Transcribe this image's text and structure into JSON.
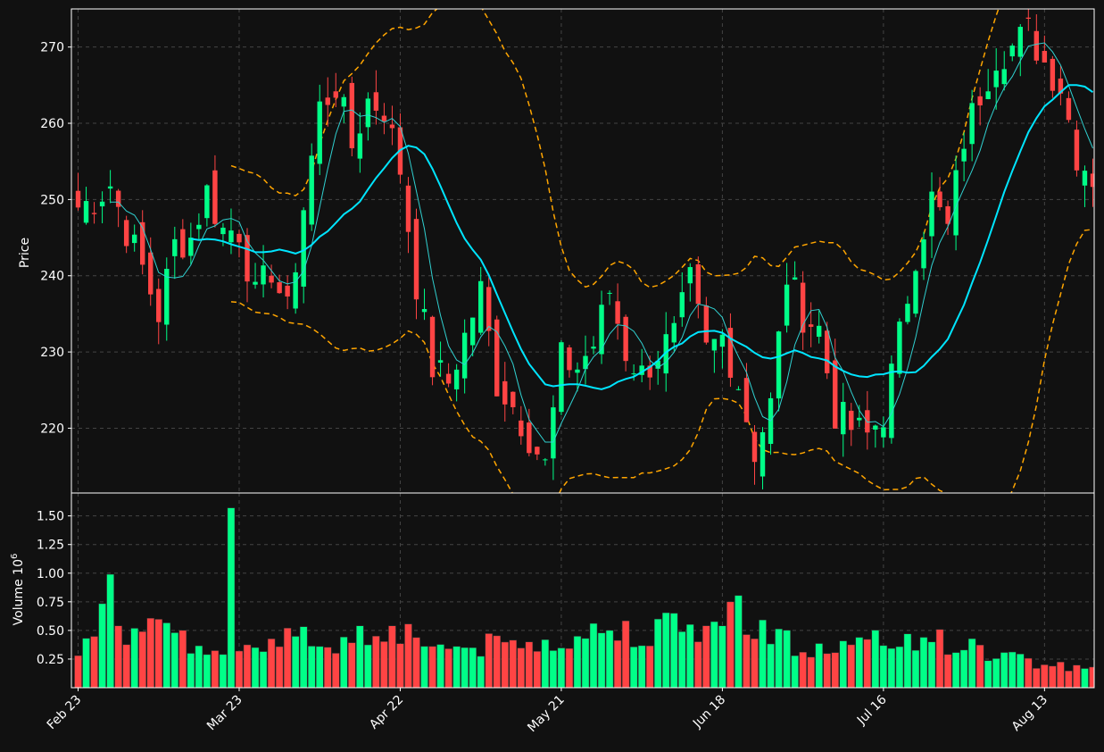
{
  "chart_data": {
    "type": "candlestick",
    "title": "",
    "background_color": "#111111",
    "grid": true,
    "colors": {
      "up": "#00ff88",
      "down": "#ff4444",
      "ma_fast": "#30d0d0",
      "ma_slow": "#00e5ff",
      "band": "#ffa500",
      "frame": "#ffffff"
    },
    "price_panel": {
      "ylabel": "Price",
      "ylim": [
        211.5,
        275
      ],
      "yticks": [
        220,
        230,
        240,
        250,
        260,
        270
      ],
      "ytick_labels": [
        "220",
        "230",
        "240",
        "250",
        "260",
        "270"
      ]
    },
    "volume_panel": {
      "ylabel": "Volume",
      "ylabel_exponent": "10",
      "ylabel_exponent_power": "6",
      "ylim": [
        0,
        1.7
      ],
      "yticks": [
        0.25,
        0.5,
        0.75,
        1.0,
        1.25,
        1.5
      ],
      "ytick_labels": [
        "0.25",
        "0.50",
        "0.75",
        "1.00",
        "1.25",
        "1.50"
      ]
    },
    "x_ticks": [
      {
        "index": 0,
        "label": "Feb 23"
      },
      {
        "index": 20,
        "label": "Mar 23"
      },
      {
        "index": 40,
        "label": "Apr 22"
      },
      {
        "index": 60,
        "label": "May 21"
      },
      {
        "index": 80,
        "label": "Jun 18"
      },
      {
        "index": 100,
        "label": "Jul 16"
      },
      {
        "index": 120,
        "label": "Aug 13"
      }
    ],
    "close_anchors": [
      [
        0,
        249
      ],
      [
        2,
        250
      ],
      [
        4,
        252
      ],
      [
        6,
        246
      ],
      [
        8,
        241
      ],
      [
        10,
        235
      ],
      [
        12,
        244
      ],
      [
        14,
        245
      ],
      [
        16,
        251
      ],
      [
        18,
        246
      ],
      [
        20,
        246
      ],
      [
        22,
        237
      ],
      [
        24,
        241
      ],
      [
        26,
        235
      ],
      [
        28,
        249
      ],
      [
        30,
        262
      ],
      [
        32,
        265
      ],
      [
        34,
        257
      ],
      [
        36,
        263
      ],
      [
        38,
        262
      ],
      [
        40,
        254
      ],
      [
        42,
        239
      ],
      [
        44,
        228
      ],
      [
        46,
        226
      ],
      [
        48,
        232
      ],
      [
        50,
        238
      ],
      [
        52,
        226
      ],
      [
        54,
        223
      ],
      [
        56,
        219
      ],
      [
        58,
        215
      ],
      [
        60,
        229
      ],
      [
        62,
        228
      ],
      [
        64,
        231
      ],
      [
        66,
        238
      ],
      [
        68,
        230
      ],
      [
        70,
        227
      ],
      [
        72,
        230
      ],
      [
        74,
        232
      ],
      [
        76,
        239
      ],
      [
        78,
        230
      ],
      [
        80,
        232
      ],
      [
        82,
        226
      ],
      [
        84,
        217
      ],
      [
        86,
        223
      ],
      [
        88,
        240
      ],
      [
        90,
        235
      ],
      [
        92,
        233
      ],
      [
        94,
        222
      ],
      [
        96,
        220
      ],
      [
        98,
        219
      ],
      [
        100,
        222
      ],
      [
        102,
        232
      ],
      [
        104,
        243
      ],
      [
        106,
        250
      ],
      [
        108,
        246
      ],
      [
        110,
        258
      ],
      [
        112,
        264
      ],
      [
        114,
        269
      ],
      [
        116,
        270
      ],
      [
        118,
        272
      ],
      [
        120,
        268
      ],
      [
        122,
        265
      ],
      [
        124,
        256
      ],
      [
        126,
        253
      ]
    ],
    "volume_anchors": [
      [
        0,
        0.28
      ],
      [
        4,
        0.99
      ],
      [
        5,
        0.54
      ],
      [
        8,
        0.49
      ],
      [
        12,
        0.48
      ],
      [
        14,
        0.3
      ],
      [
        18,
        0.29
      ],
      [
        19,
        1.57
      ],
      [
        20,
        0.32
      ],
      [
        26,
        0.52
      ],
      [
        30,
        0.36
      ],
      [
        39,
        0.54
      ],
      [
        46,
        0.34
      ],
      [
        56,
        0.4
      ],
      [
        66,
        0.5
      ],
      [
        80,
        0.54
      ],
      [
        81,
        0.75
      ],
      [
        90,
        0.31
      ],
      [
        105,
        0.44
      ],
      [
        120,
        0.2
      ],
      [
        126,
        0.18
      ]
    ],
    "series": [
      {
        "name": "",
        "kind": "ma_fast",
        "window": 5
      },
      {
        "name": "",
        "kind": "ma_slow",
        "window": 15
      }
    ],
    "bands": {
      "window": 20,
      "width_multiplier": 2
    }
  }
}
